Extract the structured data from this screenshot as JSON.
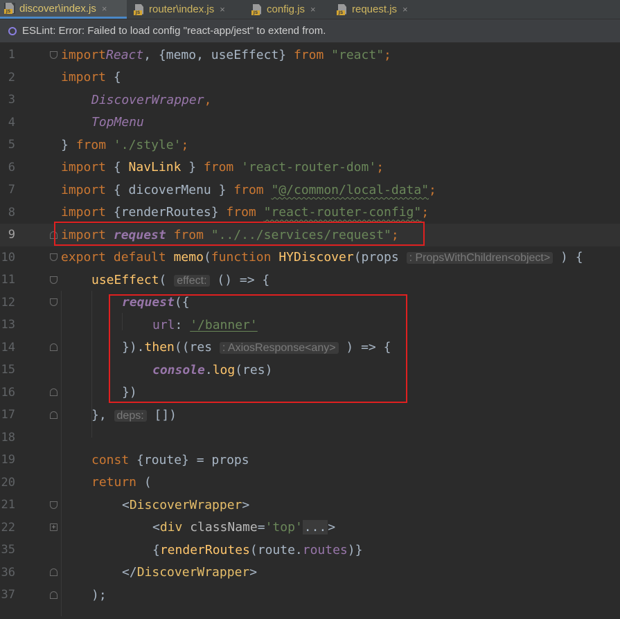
{
  "tabs": [
    {
      "label": "discover\\index.js",
      "active": true
    },
    {
      "label": "router\\index.js",
      "active": false
    },
    {
      "label": "config.js",
      "active": false
    },
    {
      "label": "request.js",
      "active": false
    }
  ],
  "tab_icon_badge": "JS",
  "tab_close_glyph": "×",
  "banner": {
    "text": "ESLint: Error: Failed to load config \"react-app/jest\" to extend from."
  },
  "line_numbers": [
    "1",
    "2",
    "3",
    "4",
    "5",
    "6",
    "7",
    "8",
    "9",
    "10",
    "11",
    "12",
    "13",
    "14",
    "15",
    "16",
    "17",
    "18",
    "19",
    "20",
    "21",
    "22",
    "35",
    "36",
    "37"
  ],
  "code": {
    "l1": {
      "kw1": "import",
      "cls": "React",
      "p1": ", {memo, useEffect} ",
      "kw2": "from",
      "p2": " ",
      "str": "\"react\"",
      "p3": ";"
    },
    "l2": {
      "kw": "import",
      "p": " {"
    },
    "l3": {
      "cls": "DiscoverWrapper",
      "p": ","
    },
    "l4": {
      "cls": "TopMenu"
    },
    "l5": {
      "p1": "} ",
      "kw": "from",
      "p2": " ",
      "str": "'./style'",
      "p3": ";"
    },
    "l6": {
      "kw1": "import",
      "p1": " { ",
      "fn": "NavLink",
      "p2": " } ",
      "kw2": "from",
      "p3": " ",
      "str": "'react-router-dom'",
      "p4": ";"
    },
    "l7": {
      "kw1": "import",
      "p1": " { dicoverMenu } ",
      "kw2": "from",
      "p2": " ",
      "str": "\"@/common/local-data\"",
      "p3": ";"
    },
    "l8": {
      "kw1": "import",
      "p1": " {renderRoutes} ",
      "kw2": "from",
      "p2": " ",
      "str": "\"react-router-config\"",
      "p3": ";"
    },
    "l9": {
      "kw1": "import",
      "p1": " ",
      "it": "request",
      "p2": " ",
      "kw2": "from",
      "p3": " ",
      "str": "\"../../services/request\"",
      "p4": ";"
    },
    "l10": {
      "kw1": "export",
      "p1": " ",
      "kw2": "default",
      "p2": " ",
      "fn1": "memo",
      "p3": "(",
      "kw3": "function",
      "p4": " ",
      "fn2": "HYDiscover",
      "p5": "(props ",
      "hint": ": PropsWithChildren<object>",
      "p6": " ) {"
    },
    "l11": {
      "fn": "useEffect",
      "p1": "( ",
      "hint": "effect:",
      "p2": " () => {"
    },
    "l12": {
      "it": "request",
      "p": "({"
    },
    "l13": {
      "prop": "url",
      "p1": ": ",
      "str": "'/banner'"
    },
    "l14": {
      "p1": "}).",
      "fn": "then",
      "p2": "((res ",
      "hint": ": AxiosResponse<any>",
      "p3": " ) => {"
    },
    "l15": {
      "it": "console",
      "p1": ".",
      "fn": "log",
      "p2": "(res)"
    },
    "l16": {
      "p": "})"
    },
    "l17": {
      "p1": "}, ",
      "hint": "deps:",
      "p2": " [])"
    },
    "l19": {
      "kw": "const",
      "p": " {route} = props"
    },
    "l20": {
      "kw": "return",
      "p": " ("
    },
    "l21": {
      "p1": "<",
      "tag": "DiscoverWrapper",
      "p2": ">"
    },
    "l22": {
      "p1": "<",
      "tag": "div",
      "p2": " ",
      "attr": "className",
      "p3": "=",
      "str": "'top'",
      "dots": "...",
      "p4": ">"
    },
    "l35": {
      "p1": "{",
      "fn": "renderRoutes",
      "p2": "(route.",
      "prop": "routes",
      "p3": ")}"
    },
    "l36": {
      "p1": "</",
      "tag": "DiscoverWrapper",
      "p2": ">"
    },
    "l37": {
      "p": ");"
    }
  }
}
